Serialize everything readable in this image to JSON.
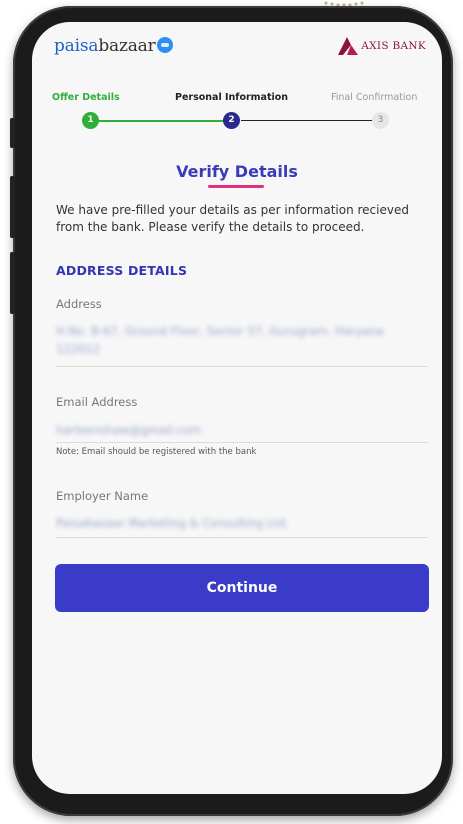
{
  "header": {
    "logo_part1": "paisa",
    "logo_part2": "bazaar",
    "bank_name": "AXIS BANK"
  },
  "steps": [
    {
      "label": "Offer Details",
      "number": "1",
      "state": "done"
    },
    {
      "label": "Personal Information",
      "number": "2",
      "state": "active"
    },
    {
      "label": "Final Confirmation",
      "number": "3",
      "state": "pending"
    }
  ],
  "title": "Verify Details",
  "intro": "We have pre-filled your details as per information recieved from the bank. Please verify the details to proceed.",
  "section_title": "ADDRESS DETAILS",
  "fields": {
    "address": {
      "label": "Address",
      "value": "H.No. B-67, Ground Floor, Sector 57, Gurugram, Haryana 122012"
    },
    "email": {
      "label": "Email Address",
      "value": "harleenshaw@gmail.com",
      "note": "Note: Email should be registered with the bank"
    },
    "employer": {
      "label": "Employer Name",
      "value": "Paisabazaar Marketing & Consulting Ltd."
    }
  },
  "continue_label": "Continue",
  "colors": {
    "primary": "#3a3bc8",
    "success": "#2fae3c",
    "accent": "#e0317a",
    "axis_maroon": "#8a1538"
  }
}
